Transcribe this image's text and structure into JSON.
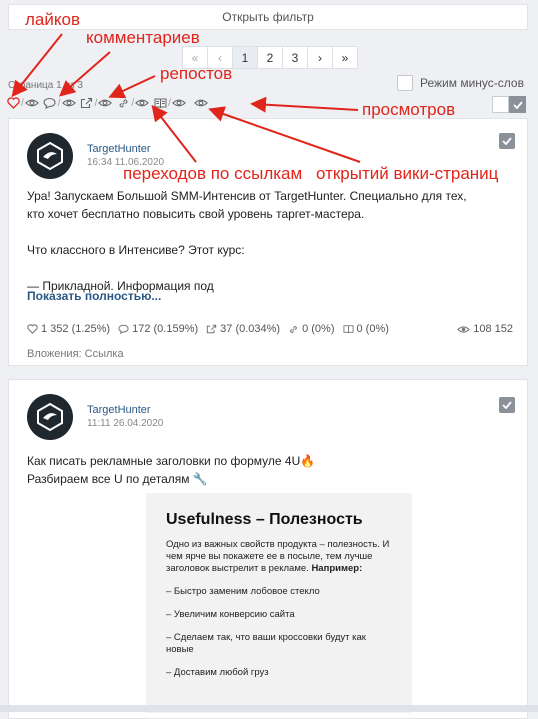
{
  "toolbar": {
    "open_filter": "Открыть фильтр"
  },
  "pager": {
    "first": "«",
    "prev": "‹",
    "p1": "1",
    "p2": "2",
    "p3": "3",
    "next": "›",
    "last": "»"
  },
  "page_info": "Страница 1 из 3",
  "minus_mode_label": "Режим минус-слов",
  "annotations": {
    "likes": "лайков",
    "comments": "комментариев",
    "reposts": "репостов",
    "views": "просмотров",
    "link_clicks": "переходов по ссылкам",
    "wiki_opens": "открытий вики-страниц"
  },
  "annotation_color": "#e0251b",
  "posts": [
    {
      "author": "TargetHunter",
      "date": "16:34 11.06.2020",
      "text_lines": [
        "Ура! Запускаем Большой SMM-Интенсив от TargetHunter. Специально для тех,",
        "кто хочет бесплатно повысить свой уровень таргет-мастера.",
        "",
        "Что классного в Интенсиве? Этот курс:",
        "",
        "— Прикладной. Информация под"
      ],
      "show_more": "Показать полностью...",
      "metrics": {
        "likes": "1 352 (1.25%)",
        "comments": "172 (0.159%)",
        "reposts": "37 (0.034%)",
        "links": "0 (0%)",
        "wiki": "0 (0%)",
        "views": "108 152"
      },
      "attachments": "Вложения: Ссылка"
    },
    {
      "author": "TargetHunter",
      "date": "11:11 26.04.2020",
      "text_lines": [
        "Как писать рекламные заголовки по формуле 4U🔥",
        "Разбираем все U по деталям 🔧"
      ],
      "image": {
        "title": "Usefulness – Полезность",
        "intro": "Одно из важных свойств продукта – полезность. И чем ярче вы покажете ее в посыле, тем лучше заголовок выстрелит в рекламе.",
        "example_label": "Например:",
        "items": [
          "– Быстро заменим лобовое стекло",
          "– Увеличим конверсию сайта",
          "– Сделаем так, что ваши кроссовки будут как новые",
          "– Доставим любой груз"
        ]
      }
    }
  ]
}
